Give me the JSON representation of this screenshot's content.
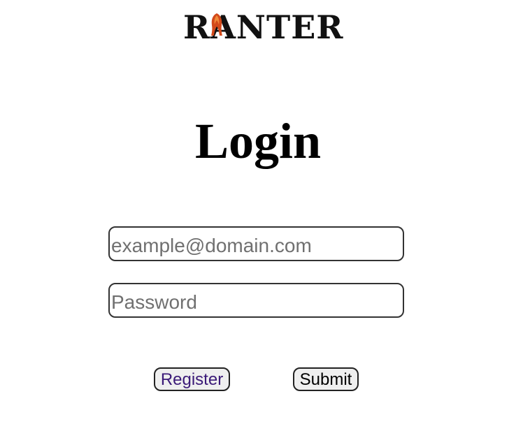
{
  "logo": {
    "text": "RANTER",
    "accent_color": "#d2491a"
  },
  "main": {
    "title": "Login"
  },
  "form": {
    "email_placeholder": "example@domain.com",
    "email_value": "",
    "password_placeholder": "Password",
    "password_value": ""
  },
  "actions": {
    "register_label": "Register",
    "submit_label": "Submit"
  }
}
